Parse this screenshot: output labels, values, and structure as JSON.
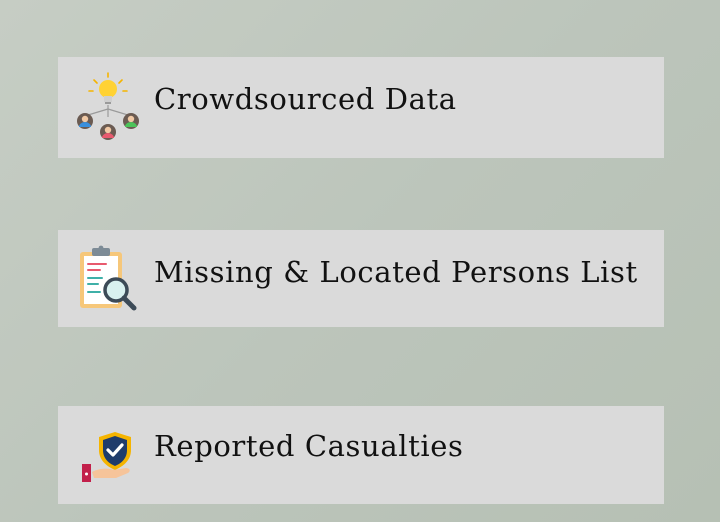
{
  "menu": {
    "items": [
      {
        "label": "Crowdsourced Data",
        "icon": "crowdsource-lightbulb-icon"
      },
      {
        "label": "Missing & Located Persons List",
        "icon": "clipboard-search-icon"
      },
      {
        "label": "Reported Casualties",
        "icon": "shield-hand-icon"
      }
    ]
  },
  "colors": {
    "background": "#bfc8be",
    "card": "#dadada",
    "text": "#111111"
  }
}
